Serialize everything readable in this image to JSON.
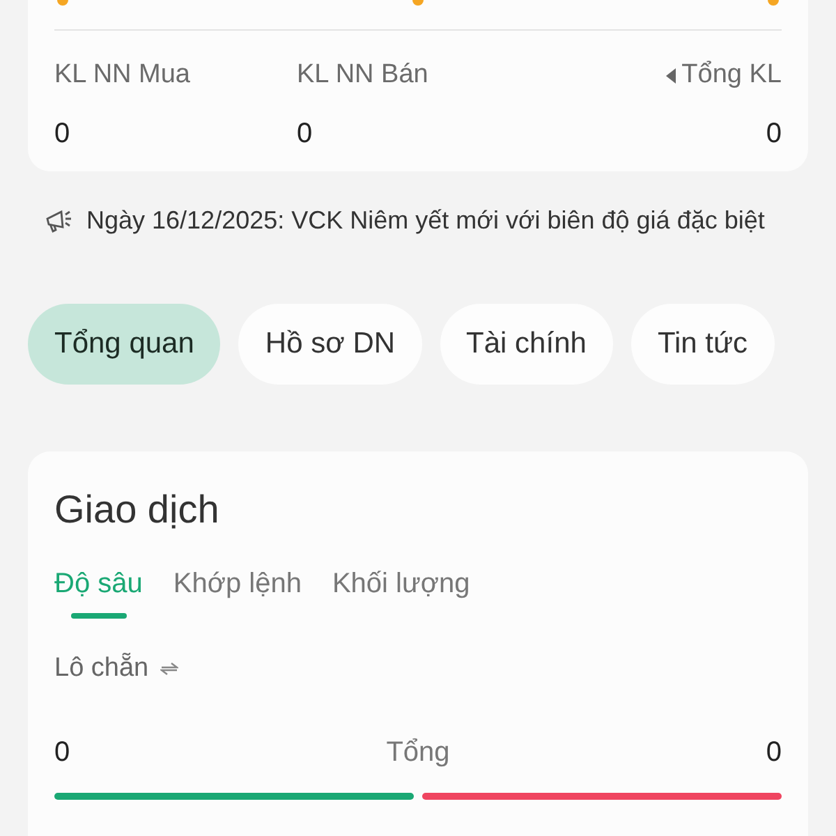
{
  "foreign_stats": [
    {
      "label": "KL NN Mua",
      "value": "0",
      "sort_arrow": false
    },
    {
      "label": "KL NN Bán",
      "value": "0",
      "sort_arrow": false
    },
    {
      "label": "Tổng KL",
      "value": "0",
      "sort_arrow": true
    }
  ],
  "notice": "Ngày 16/12/2025: VCK Niêm yết mới với biên độ giá đặc biệt",
  "tabs": [
    {
      "label": "Tổng quan",
      "selected": true
    },
    {
      "label": "Hồ sơ DN",
      "selected": false
    },
    {
      "label": "Tài chính",
      "selected": false
    },
    {
      "label": "Tin tức",
      "selected": false
    }
  ],
  "trading": {
    "title": "Giao dịch",
    "subtabs": [
      {
        "label": "Độ sâu",
        "selected": true
      },
      {
        "label": "Khớp lệnh",
        "selected": false
      },
      {
        "label": "Khối lượng",
        "selected": false
      }
    ],
    "lot_label": "Lô chẵn",
    "buy_total": "0",
    "total_label": "Tổng",
    "sell_total": "0"
  }
}
